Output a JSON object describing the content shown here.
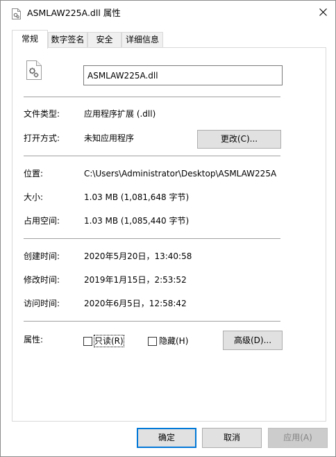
{
  "window": {
    "title": "ASMLAW225A.dll 属性",
    "close_icon": "close-icon",
    "title_icon": "dll-file-icon"
  },
  "tabs": [
    {
      "label": "常规",
      "active": true
    },
    {
      "label": "数字签名",
      "active": false
    },
    {
      "label": "安全",
      "active": false
    },
    {
      "label": "详细信息",
      "active": false
    }
  ],
  "general": {
    "file_icon": "dll-gear-file-icon",
    "file_name": "ASMLAW225A.dll",
    "file_type_label": "文件类型:",
    "file_type_value": "应用程序扩展 (.dll)",
    "opens_with_label": "打开方式:",
    "opens_with_value": "未知应用程序",
    "change_button": "更改(C)...",
    "location_label": "位置:",
    "location_value": "C:\\Users\\Administrator\\Desktop\\ASMLAW225A",
    "size_label": "大小:",
    "size_value": "1.03 MB (1,081,648 字节)",
    "size_on_disk_label": "占用空间:",
    "size_on_disk_value": "1.03 MB (1,085,440 字节)",
    "created_label": "创建时间:",
    "created_value": "2020年5月20日，13:40:58",
    "modified_label": "修改时间:",
    "modified_value": "2019年1月15日，2:53:52",
    "accessed_label": "访问时间:",
    "accessed_value": "2020年6月5日，12:58:42",
    "attributes_label": "属性:",
    "readonly_label": "只读(R)",
    "readonly_checked": false,
    "hidden_label": "隐藏(H)",
    "hidden_checked": false,
    "advanced_button": "高级(D)..."
  },
  "footer": {
    "ok_button": "确定",
    "cancel_button": "取消",
    "apply_button": "应用(A)"
  },
  "colors": {
    "focus_border": "#0078d7",
    "button_bg": "#e1e1e1",
    "disabled_bg": "#cccccc",
    "disabled_text": "#838383",
    "separator": "#a0a0a0"
  }
}
